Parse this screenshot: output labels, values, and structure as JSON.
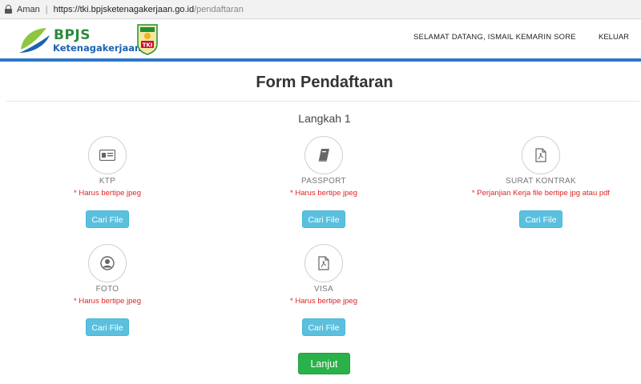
{
  "browser": {
    "secure_label": "Aman",
    "url_host": "https://tki.bpjsketenagakerjaan.go.id",
    "url_path": "/pendaftaran"
  },
  "header": {
    "brand_line1": "BPJS",
    "brand_line2": "Ketenagakerjaan",
    "welcome": "SELAMAT DATANG, ISMAIL KEMARIN SORE",
    "logout": "KELUAR",
    "accent_color": "#2d78c8"
  },
  "form": {
    "title": "Form Pendaftaran",
    "step": "Langkah 1",
    "fields": [
      {
        "label": "KTP",
        "note": "* Harus bertipe jpeg",
        "button": "Cari File",
        "icon": "id-card-icon"
      },
      {
        "label": "PASSPORT",
        "note": "* Harus bertipe jpeg",
        "button": "Cari File",
        "icon": "book-icon"
      },
      {
        "label": "SURAT KONTRAK",
        "note": "* Perjanjian Kerja file bertipe jpg atau pdf",
        "button": "Cari File",
        "icon": "pdf-icon"
      },
      {
        "label": "FOTO",
        "note": "* Harus bertipe jpeg",
        "button": "Cari File",
        "icon": "user-icon"
      },
      {
        "label": "VISA",
        "note": "* Harus bertipe jpeg",
        "button": "Cari File",
        "icon": "pdf-icon"
      }
    ],
    "submit": "Lanjut"
  }
}
